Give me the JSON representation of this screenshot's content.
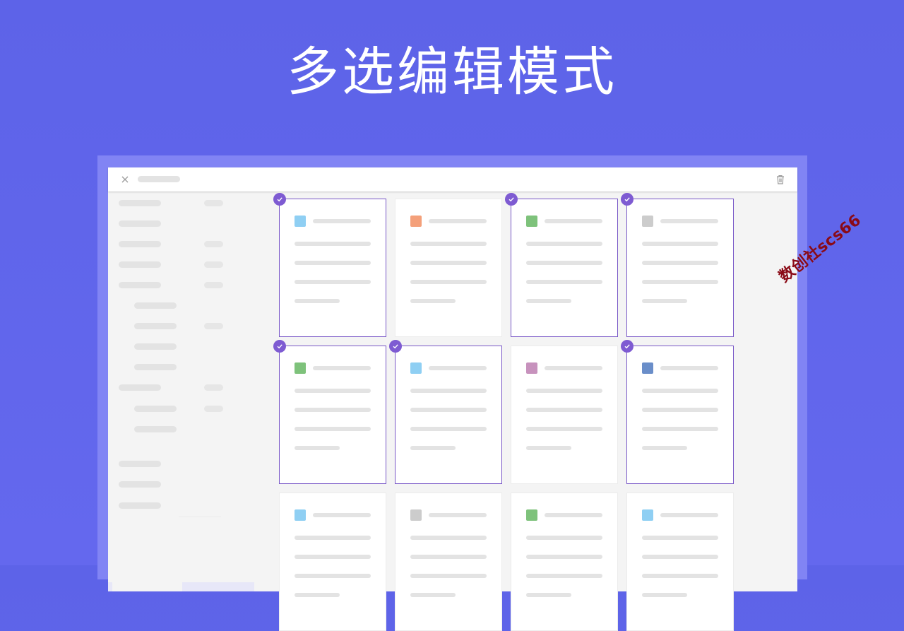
{
  "headline": "多选编辑模式",
  "watermark": "数创社scs66",
  "toolbar": {
    "close_icon": "close-icon",
    "delete_icon": "trash-icon"
  },
  "sidebar": {
    "items": [
      {
        "indent": false,
        "has_count": true
      },
      {
        "indent": false,
        "has_count": false
      },
      {
        "indent": false,
        "has_count": true
      },
      {
        "indent": false,
        "has_count": true
      },
      {
        "indent": false,
        "has_count": true
      },
      {
        "indent": true,
        "has_count": false
      },
      {
        "indent": true,
        "has_count": true
      },
      {
        "indent": true,
        "has_count": false
      },
      {
        "indent": true,
        "has_count": false
      },
      {
        "indent": false,
        "has_count": true
      },
      {
        "indent": true,
        "has_count": true
      },
      {
        "indent": true,
        "has_count": false
      },
      {
        "indent": false,
        "has_count": false
      },
      {
        "indent": false,
        "has_count": false
      },
      {
        "indent": false,
        "has_count": false
      }
    ]
  },
  "cards": [
    {
      "color": "#8fcff3",
      "selected": true
    },
    {
      "color": "#f4a07a",
      "selected": false
    },
    {
      "color": "#7ec27b",
      "selected": true
    },
    {
      "color": "#cccccc",
      "selected": true
    },
    {
      "color": "#7ec27b",
      "selected": true
    },
    {
      "color": "#8fcff3",
      "selected": true
    },
    {
      "color": "#c792bd",
      "selected": false
    },
    {
      "color": "#6a8ec9",
      "selected": true
    },
    {
      "color": "#8fcff3",
      "selected": false
    },
    {
      "color": "#cccccc",
      "selected": false
    },
    {
      "color": "#7ec27b",
      "selected": false
    },
    {
      "color": "#8fcff3",
      "selected": false
    }
  ]
}
